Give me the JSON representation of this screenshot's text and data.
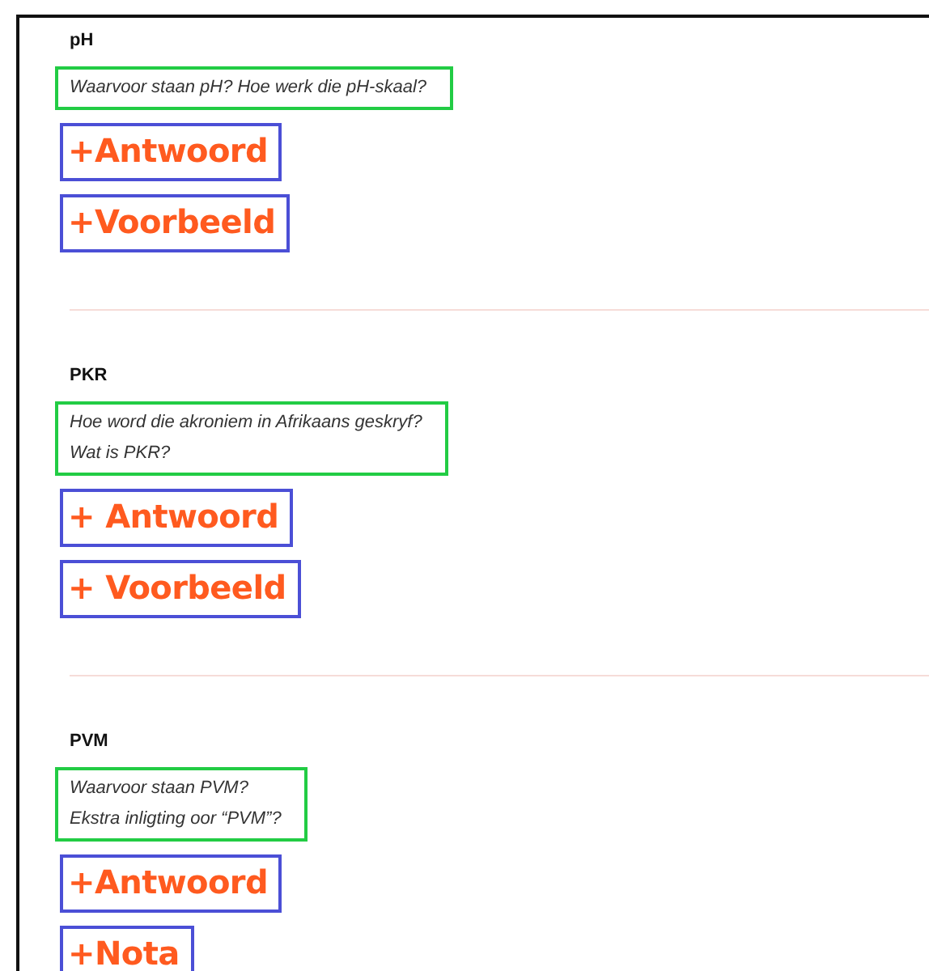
{
  "sections": [
    {
      "title": "pH",
      "questions": [
        "Waarvoor staan pH? Hoe werk die pH-skaal?"
      ],
      "buttons": [
        "+Antwoord",
        "+Voorbeeld"
      ]
    },
    {
      "title": "PKR",
      "questions": [
        "Hoe word die akroniem in Afrikaans geskryf?",
        "Wat is PKR?"
      ],
      "buttons": [
        "+ Antwoord",
        "+ Voorbeeld"
      ]
    },
    {
      "title": "PVM",
      "questions": [
        "Waarvoor staan PVM?",
        "Ekstra inligting oor “PVM”?"
      ],
      "buttons": [
        "+Antwoord",
        "+Nota"
      ]
    }
  ]
}
